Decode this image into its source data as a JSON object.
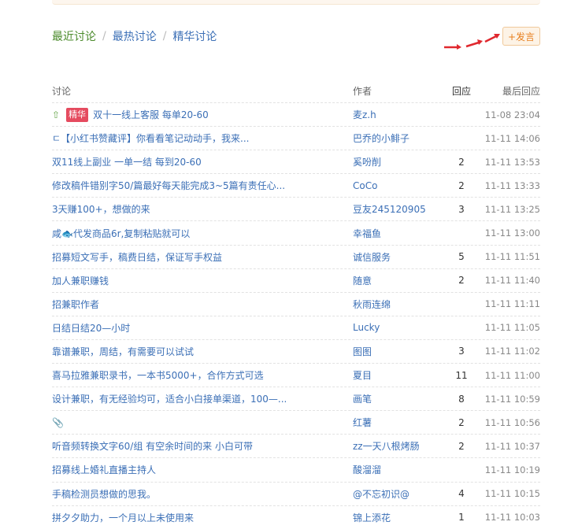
{
  "tabs": [
    "最近讨论",
    "最热讨论",
    "精华讨论"
  ],
  "tab_separator": "/",
  "post_button_label": "+发言",
  "table": {
    "headers": {
      "title": "讨论",
      "author": "作者",
      "replies": "回应",
      "last": "最后回应"
    },
    "rows": [
      {
        "prefix": "⇧",
        "badge": "精华",
        "title": "双十一线上客服 每单20-60",
        "author": "麦z.h",
        "replies": "",
        "time": "11-08 23:04"
      },
      {
        "prefix": "",
        "badge": "",
        "title": "ㄷ【小红书赞藏评】你看看笔记动动手，我来...",
        "author": "巴乔的小鲱子",
        "replies": "",
        "time": "11-11 14:06"
      },
      {
        "prefix": "",
        "badge": "",
        "title": "双11线上副业 一单一结 每到20-60",
        "author": "奚吩削",
        "replies": "2",
        "time": "11-11 13:53"
      },
      {
        "prefix": "",
        "badge": "",
        "title": "修改稿件错别字50/篇最好每天能完成3~5篇有责任心...",
        "author": "CoCo",
        "replies": "2",
        "time": "11-11 13:33"
      },
      {
        "prefix": "",
        "badge": "",
        "title": "3天赚100+，想做的来",
        "author": "豆友245120905",
        "replies": "3",
        "time": "11-11 13:25"
      },
      {
        "prefix": "",
        "badge": "",
        "title": "咸🐟代发商品6r,复制粘贴就可以",
        "author": "幸福鱼",
        "replies": "",
        "time": "11-11 13:00"
      },
      {
        "prefix": "",
        "badge": "",
        "title": "招募短文写手，稿费日结，保证写手权益",
        "author": "诚信服务",
        "replies": "5",
        "time": "11-11 11:51"
      },
      {
        "prefix": "",
        "badge": "",
        "title": "加人兼职赚钱",
        "author": "随意",
        "replies": "2",
        "time": "11-11 11:40"
      },
      {
        "prefix": "",
        "badge": "",
        "title": "招兼职作者",
        "author": "秋雨连绵",
        "replies": "",
        "time": "11-11 11:11"
      },
      {
        "prefix": "",
        "badge": "",
        "title": "日结日结20—小时",
        "author": "Lucky",
        "replies": "",
        "time": "11-11 11:05"
      },
      {
        "prefix": "",
        "badge": "",
        "title": "靠谱兼职，周结，有需要可以试试",
        "author": "图图",
        "replies": "3",
        "time": "11-11 11:02"
      },
      {
        "prefix": "",
        "badge": "",
        "title": "喜马拉雅兼职录书，一本书5000+，合作方式可选",
        "author": "夏目",
        "replies": "11",
        "time": "11-11 11:00"
      },
      {
        "prefix": "",
        "badge": "",
        "title": "设计兼职，有无经验均可，适合小白接单渠道，100—...",
        "author": "画笔",
        "replies": "8",
        "time": "11-11 10:59"
      },
      {
        "prefix": "",
        "badge": "",
        "title": "📎",
        "author": "红薯",
        "replies": "2",
        "time": "11-11 10:56"
      },
      {
        "prefix": "",
        "badge": "",
        "title": "听音频转换文字60/组 有空余时间的来 小白可带",
        "author": "zz一天八根烤肠",
        "replies": "2",
        "time": "11-11 10:37"
      },
      {
        "prefix": "",
        "badge": "",
        "title": "招募线上婚礼直播主持人",
        "author": "酸溜溜",
        "replies": "",
        "time": "11-11 10:19"
      },
      {
        "prefix": "",
        "badge": "",
        "title": "手稿检测员想做的思我。",
        "author": "@不忘初识@",
        "replies": "4",
        "time": "11-11 10:15"
      },
      {
        "prefix": "",
        "badge": "",
        "title": "拼夕夕助力，一个月以上未使用来",
        "author": "锦上添花",
        "replies": "1",
        "time": "11-11 10:03"
      }
    ]
  },
  "colors": {
    "link": "#3b6fb6",
    "active_tab": "#4a8a2a",
    "badge_bg": "#e54b5f",
    "arrow": "#e0282e",
    "post_button_text": "#e77f1d"
  }
}
